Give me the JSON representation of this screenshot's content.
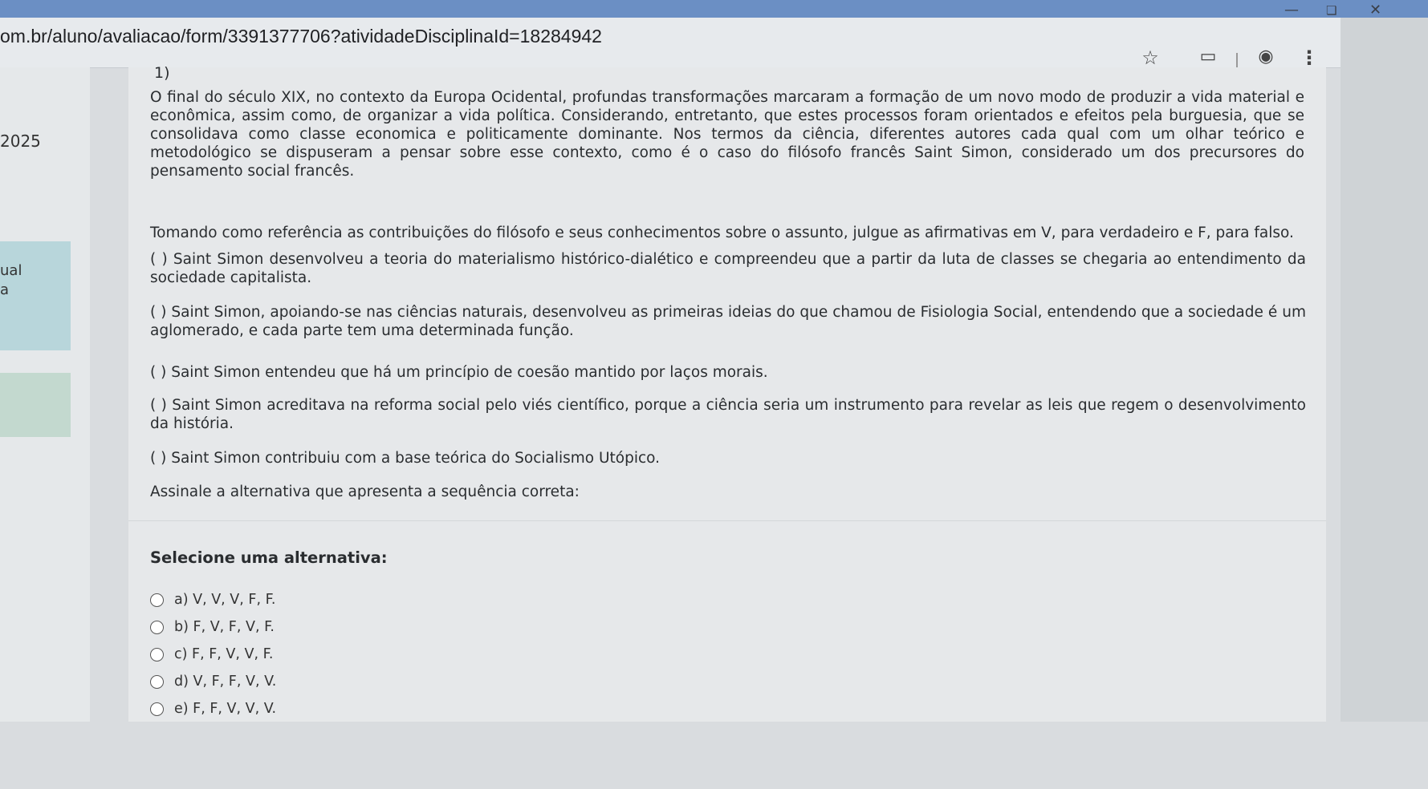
{
  "browser": {
    "url": "om.br/aluno/avaliacao/form/3391377706?atividadeDisciplinaId=18284942",
    "icons": [
      "bookmark-star-icon",
      "extensions-icon",
      "profile-icon",
      "menu-kebab-icon"
    ],
    "window_controls": [
      "minimize-icon",
      "restore-icon",
      "close-icon"
    ]
  },
  "sidebar": {
    "year_text": "2025",
    "item_text_1": "ual",
    "item_text_2": "a"
  },
  "question": {
    "number": "1)",
    "intro": "O final do século XIX, no contexto da Europa Ocidental, profundas transformações marcaram a formação de um novo modo de produzir a vida material e econômica, assim como, de organizar a vida política. Considerando, entretanto, que estes processos foram orientados e efeitos pela burguesia, que se consolidava como classe economica e politicamente dominante. Nos termos da ciência, diferentes autores cada qual com um olhar teórico e metodológico se dispuseram a pensar sobre esse contexto, como é o caso do filósofo francês Saint Simon, considerado um dos precursores do pensamento social francês.",
    "prompt": "Tomando como referência as contribuições do filósofo e seus conhecimentos sobre o assunto, julgue as afirmativas em V, para verdadeiro e F, para falso.",
    "statements": [
      "( ) Saint Simon desenvolveu a teoria do materialismo histórico-dialético e compreendeu que a partir da luta de classes se chegaria ao entendimento da sociedade capitalista.",
      "( ) Saint Simon, apoiando-se nas ciências naturais, desenvolveu as primeiras ideias do que chamou de Fisiologia Social, entendendo que a sociedade é um aglomerado, e cada parte tem uma determinada função.",
      "( ) Saint Simon entendeu que há um princípio de coesão mantido por laços morais.",
      "( ) Saint Simon acreditava na reforma social pelo viés científico, porque a ciência seria um instrumento para revelar as leis que regem o desenvolvimento da história.",
      "( ) Saint Simon contribuiu com a base teórica do Socialismo Utópico."
    ],
    "instruction": "Assinale a alternativa que apresenta a sequência correta:"
  },
  "answers": {
    "label": "Selecione uma alternativa:",
    "options": [
      "a) V, V, V, F, F.",
      "b) F, V, F, V, F.",
      "c) F, F, V, V, F.",
      "d) V, F, F, V, V.",
      "e) F, F, V, V, V."
    ]
  }
}
